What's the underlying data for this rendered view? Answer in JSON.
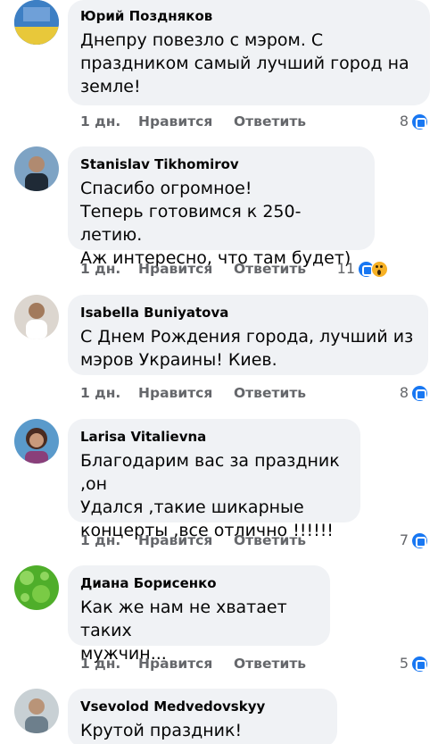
{
  "comments": [
    {
      "author": "Юрий Поздняков",
      "text": "Днепру повезло с мэром. С\nпраздником самый лучший город на\nземле!",
      "time": "1 дн.",
      "like": "Нравится",
      "reply": "Ответить",
      "reactions_count": "8",
      "reactions": [
        "like-icon"
      ],
      "avatar_color": "#2e6fb5"
    },
    {
      "author": "Stanislav Tikhomirov",
      "text": "Спасибо огромное!\nТеперь готовимся к 250-летию.\nАж интересно, что там будет)",
      "time": "1 дн.",
      "like": "Нравится",
      "reply": "Ответить",
      "reactions_count": "11",
      "reactions": [
        "like-icon",
        "wow-icon"
      ],
      "avatar_color": "#4a6d8c"
    },
    {
      "author": "Isabella Buniyatova",
      "text": "С Днем Рождения города, лучший из\nмэров Украины! Киев.",
      "time": "1 дн.",
      "like": "Нравится",
      "reply": "Ответить",
      "reactions_count": "8",
      "reactions": [
        "like-icon"
      ],
      "avatar_color": "#c9b8a6"
    },
    {
      "author": "Larisa Vitalievna",
      "text": "Благодарим вас за праздник ,он\nУдался ,такие шикарные\nконцерты ,все отлично !!!!!!",
      "time": "1 дн.",
      "like": "Нравится",
      "reply": "Ответить",
      "reactions_count": "7",
      "reactions": [
        "like-icon"
      ],
      "avatar_color": "#8a6a5a"
    },
    {
      "author": "Диана Борисенко",
      "text": "Как же нам не хватает таких\nмужчин...",
      "time": "1 дн.",
      "like": "Нравится",
      "reply": "Ответить",
      "reactions_count": "5",
      "reactions": [
        "like-icon"
      ],
      "avatar_color": "#5cb531"
    },
    {
      "author": "Vsevolod Medvedovskyy",
      "text": "Крутой праздник! Спасибо!",
      "avatar_color": "#9aa6ad"
    }
  ]
}
